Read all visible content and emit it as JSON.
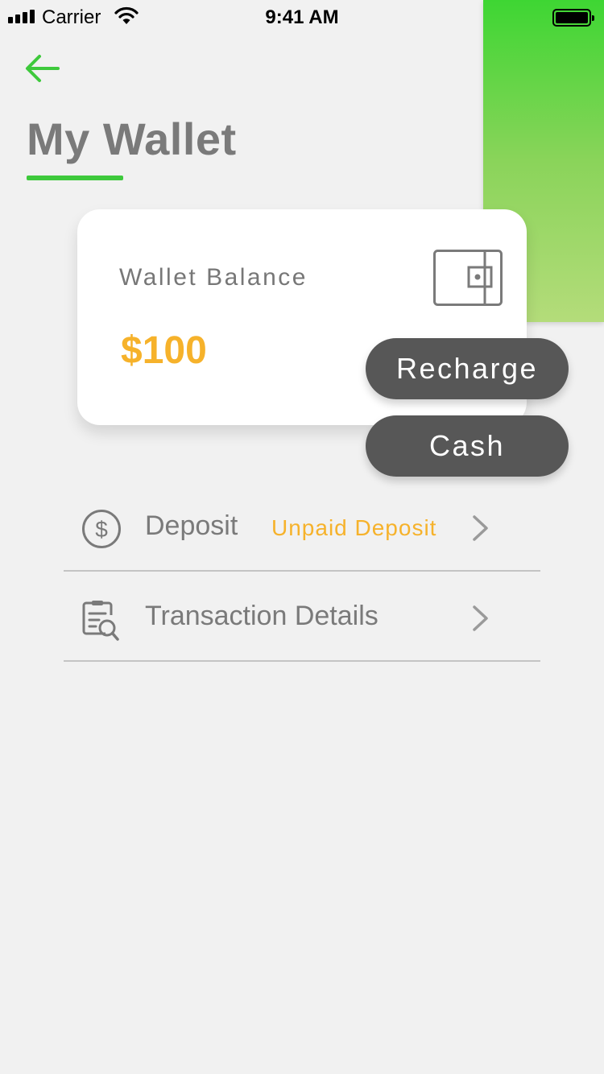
{
  "status_bar": {
    "carrier": "Carrier",
    "time": "9:41 AM"
  },
  "colors": {
    "accent_green": "#3ec93c",
    "amount_orange": "#f6b22b",
    "button_dark": "#575757"
  },
  "header": {
    "back_icon": "arrow-left-icon",
    "title": "My Wallet"
  },
  "balance_card": {
    "label": "Wallet Balance",
    "amount": "$100",
    "icon": "wallet-icon"
  },
  "actions": {
    "recharge_label": "Recharge",
    "cash_label": "Cash"
  },
  "menu": {
    "items": [
      {
        "icon": "dollar-circle-icon",
        "label": "Deposit",
        "sub_label": "Unpaid Deposit"
      },
      {
        "icon": "clipboard-search-icon",
        "label": "Transaction Details"
      }
    ]
  }
}
